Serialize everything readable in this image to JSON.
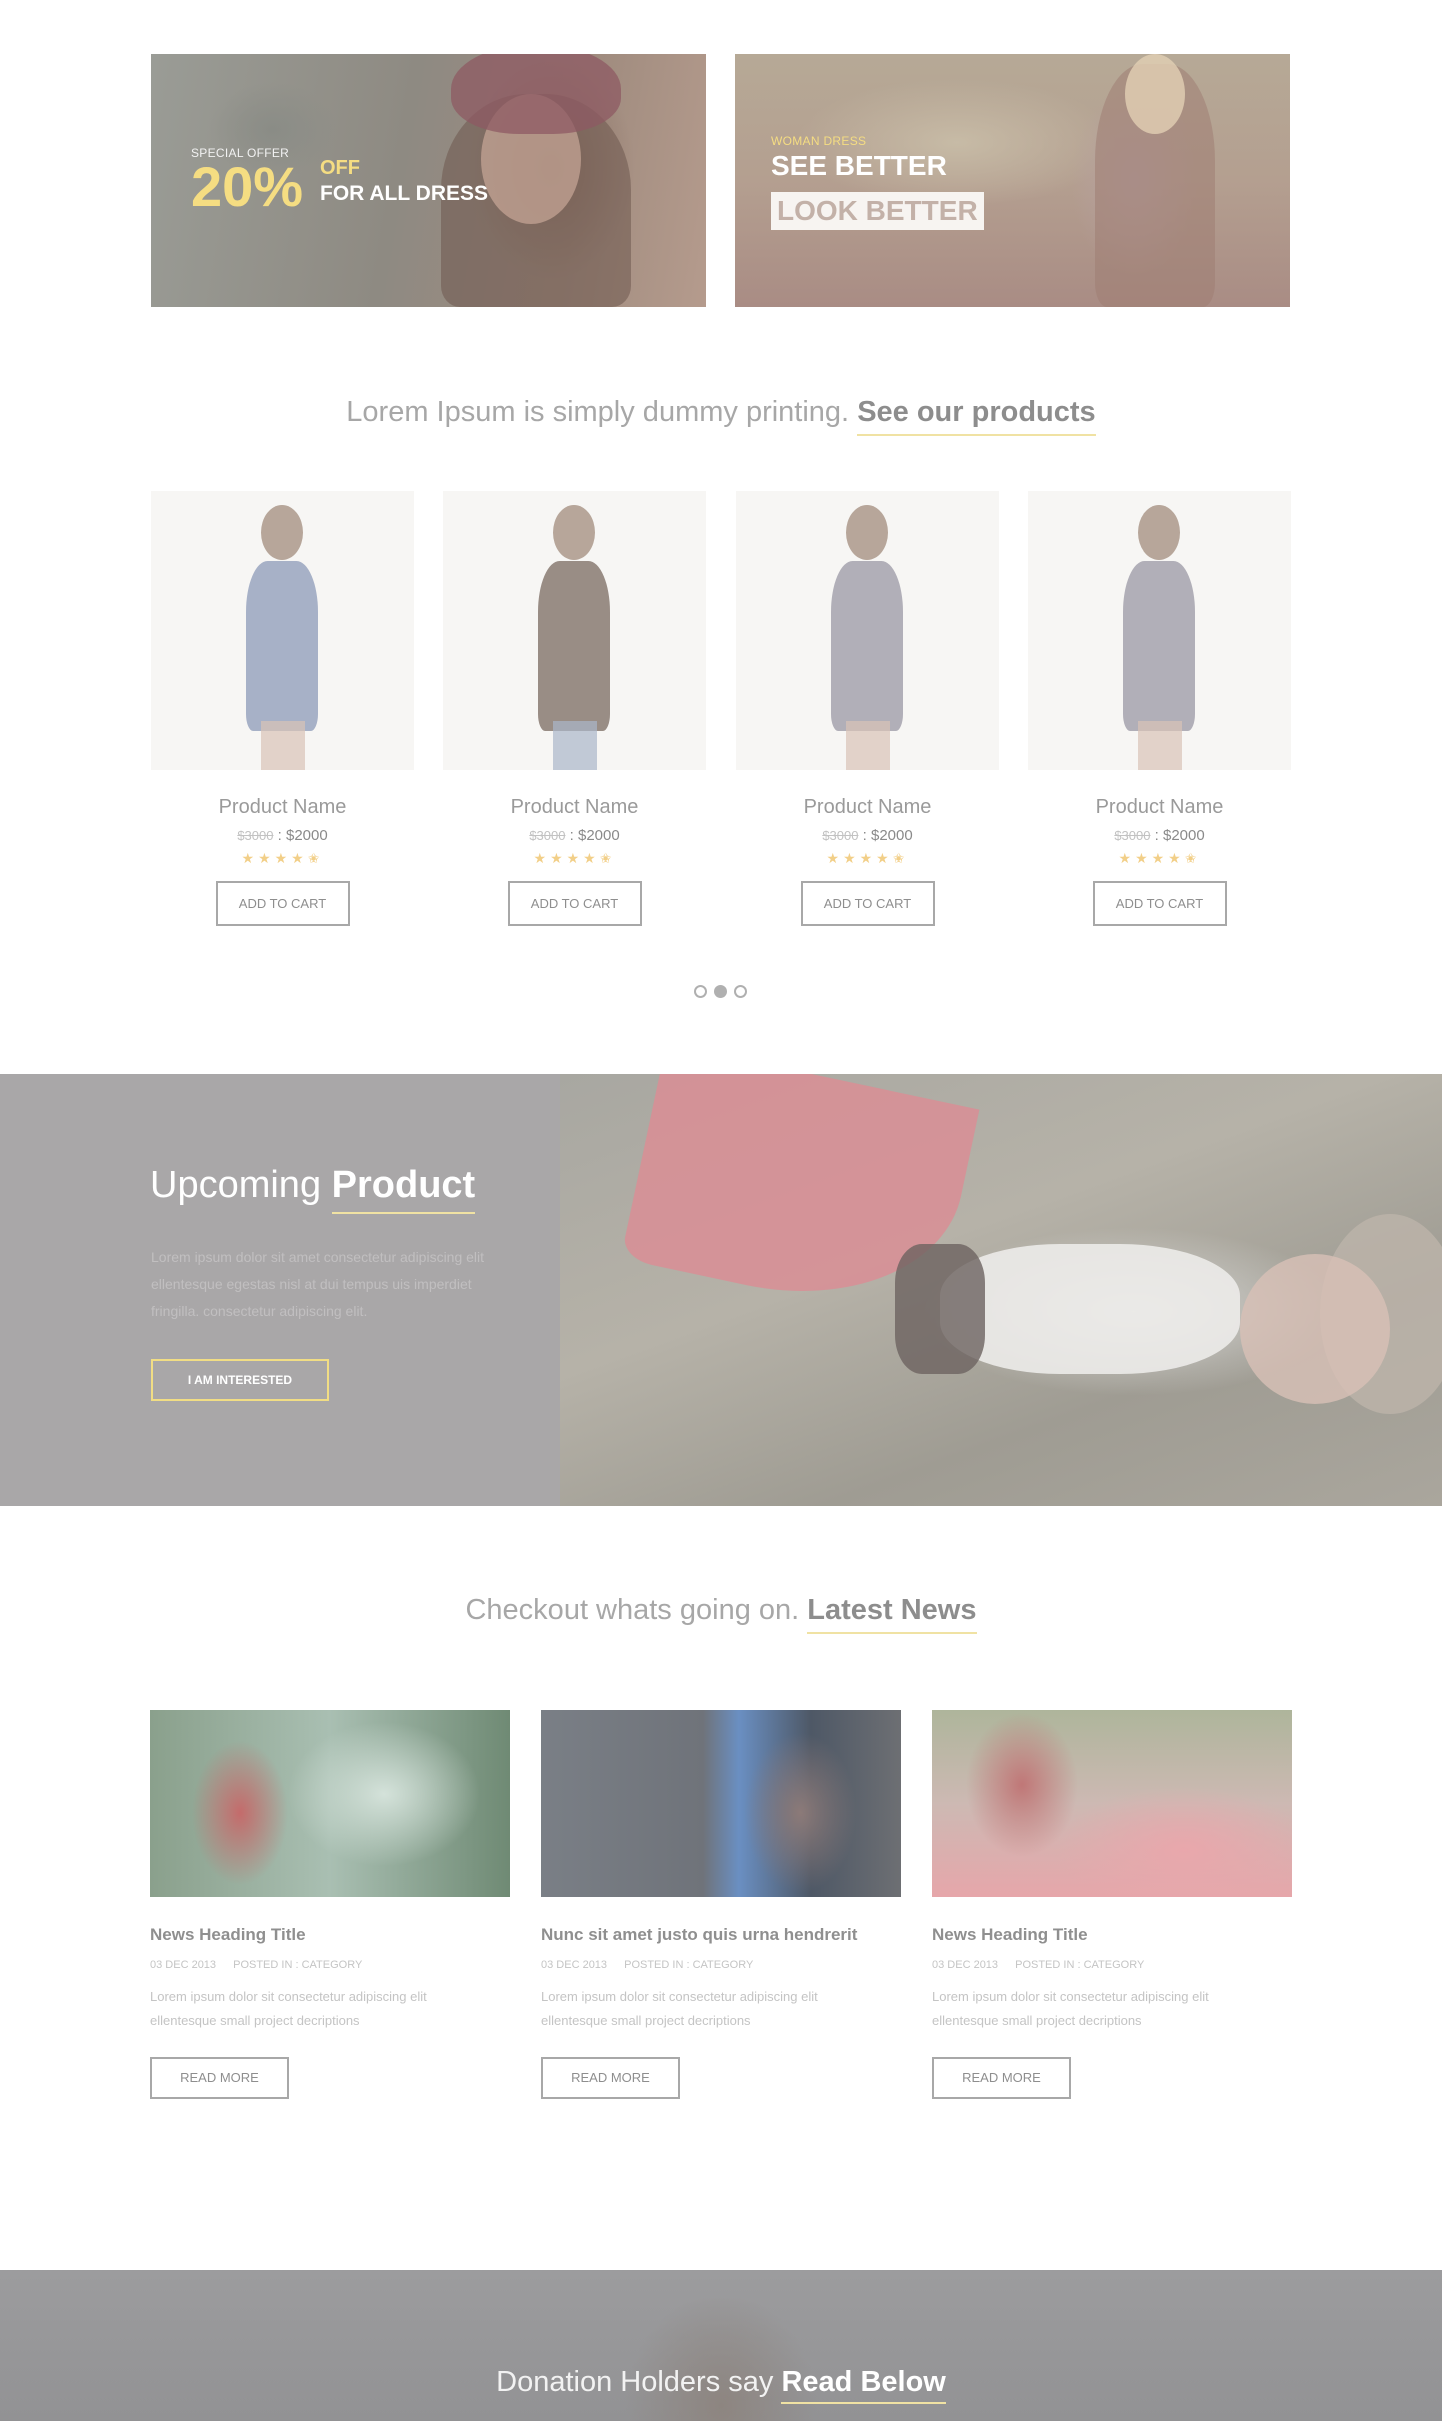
{
  "banners": {
    "left": {
      "small": "SPECIAL OFFER",
      "big": "20%",
      "off": "OFF",
      "tagline": "FOR ALL DRESS"
    },
    "right": {
      "small": "WOMAN DRESS",
      "line1": "SEE BETTER",
      "line2": "LOOK BETTER"
    }
  },
  "products_section": {
    "heading_light": "Lorem Ipsum is simply dummy printing.",
    "heading_strong": "See our products",
    "items": [
      {
        "name": "Product Name",
        "old_price": "$3000",
        "new_price": ": $2000",
        "stars": "★★★★✬",
        "button": "ADD TO CART",
        "color": "#8c9ab8"
      },
      {
        "name": "Product Name",
        "old_price": "$3000",
        "new_price": ": $2000",
        "stars": "★★★★✬",
        "button": "ADD TO CART",
        "color": "#7a6960"
      },
      {
        "name": "Product Name",
        "old_price": "$3000",
        "new_price": ": $2000",
        "stars": "★★★★✬",
        "button": "ADD TO CART",
        "color": "#9a97a4"
      },
      {
        "name": "Product Name",
        "old_price": "$3000",
        "new_price": ": $2000",
        "stars": "★★★★✬",
        "button": "ADD TO CART",
        "color": "#9a97a4"
      }
    ],
    "carousel": {
      "pages": 3,
      "active": 2
    }
  },
  "upcoming": {
    "title_light": "Upcoming",
    "title_strong": "Product",
    "text": "Lorem ipsum dolor sit amet consectetur adipiscing elit ellentesque egestas nisl at dui tempus uis imperdiet fringilla. consectetur adipiscing elit.",
    "button": "I AM INTERESTED"
  },
  "news_section": {
    "heading_light": "Checkout whats going on.",
    "heading_strong": "Latest News",
    "items": [
      {
        "title": "News Heading Title",
        "date": "03 DEC 2013",
        "posted": "POSTED IN : CATEGORY",
        "text": "Lorem ipsum dolor sit consectetur adipiscing elit ellentesque small project decriptions",
        "button": "READ MORE"
      },
      {
        "title": "Nunc sit amet justo quis urna hendrerit",
        "date": "03 DEC 2013",
        "posted": "POSTED IN : CATEGORY",
        "text": "Lorem ipsum dolor sit consectetur adipiscing elit ellentesque small project decriptions",
        "button": "READ MORE"
      },
      {
        "title": "News Heading Title",
        "date": "03 DEC 2013",
        "posted": "POSTED IN : CATEGORY",
        "text": "Lorem ipsum dolor sit consectetur adipiscing elit ellentesque small project decriptions",
        "button": "READ MORE"
      }
    ]
  },
  "donation": {
    "title_light": "Donation Holders say",
    "title_strong": "Read Below"
  },
  "colors": {
    "accent": "#f5dd82",
    "underline": "#f0e2a3",
    "panel": "#a9a7a8"
  }
}
